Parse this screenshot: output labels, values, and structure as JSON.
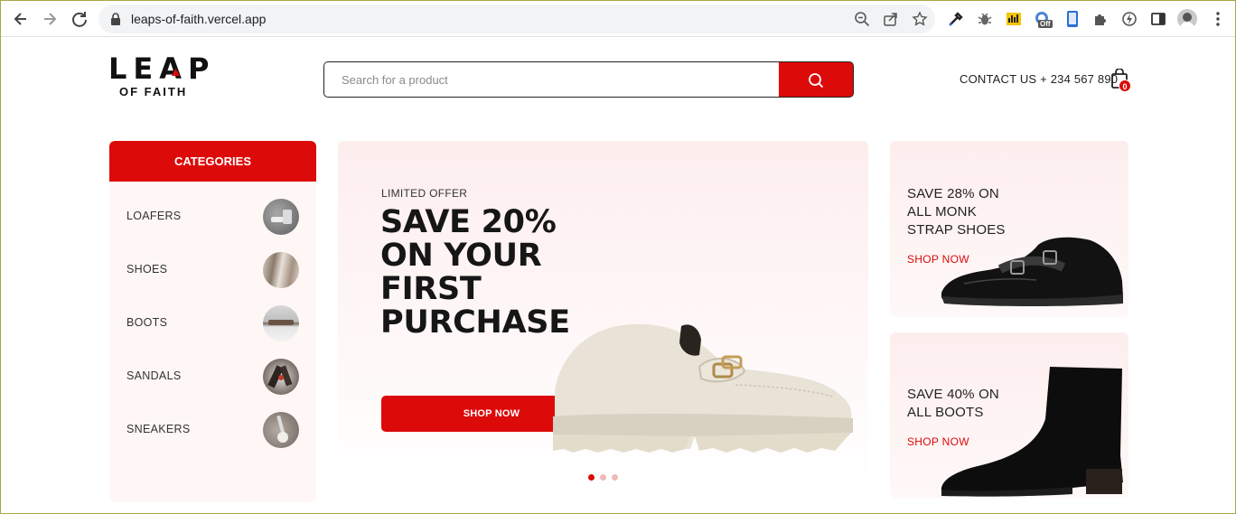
{
  "browser": {
    "url": "leaps-of-faith.vercel.app",
    "icons": [
      "back-icon",
      "forward-icon",
      "reload-icon",
      "lock-icon",
      "zoom-icon",
      "share-icon",
      "star-icon",
      "eyedropper-icon",
      "bug-icon",
      "chart-icon",
      "ext-off-icon",
      "ext-phone-icon",
      "puzzle-icon",
      "bolt-icon",
      "sidepanel-icon",
      "avatar-icon",
      "menu-icon"
    ],
    "ext_badge": "Off"
  },
  "header": {
    "logo_line1": "LEAP",
    "logo_line2": "OF FAITH",
    "search_placeholder": "Search for a product",
    "contact": "CONTACT  US + 234 567 890",
    "cart_count": "0"
  },
  "categories": {
    "title": "CATEGORIES",
    "items": [
      {
        "label": "LOAFERS"
      },
      {
        "label": "SHOES"
      },
      {
        "label": "BOOTS"
      },
      {
        "label": "SANDALS"
      },
      {
        "label": "SNEAKERS"
      }
    ]
  },
  "hero": {
    "tag": "LIMITED OFFER",
    "title": "SAVE 20% ON YOUR FIRST PURCHASE",
    "button": "SHOP NOW",
    "active_slide": 1,
    "slides": 3
  },
  "promos": [
    {
      "title": "SAVE 28% ON ALL MONK STRAP SHOES",
      "link": "SHOP NOW"
    },
    {
      "title": "SAVE 40% ON ALL BOOTS",
      "link": "SHOP NOW"
    }
  ],
  "colors": {
    "accent": "#dd0a0a",
    "panel": "#fff6f6"
  }
}
